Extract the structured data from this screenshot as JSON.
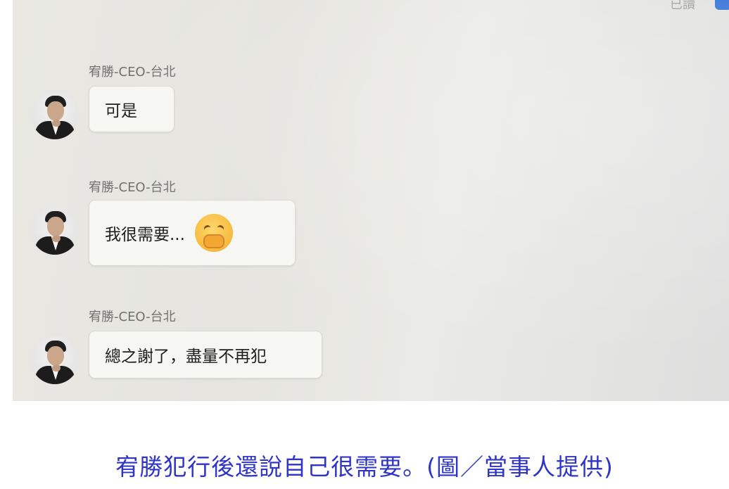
{
  "header": {
    "read_status": "已讀"
  },
  "messages": [
    {
      "sender": "宥勝-CEO-台北",
      "text": "可是",
      "emoji": null
    },
    {
      "sender": "宥勝-CEO-台北",
      "text": "我很需要...",
      "emoji": "covering-mouth-face-emoji"
    },
    {
      "sender": "宥勝-CEO-台北",
      "text": "總之謝了，盡量不再犯",
      "emoji": null
    }
  ],
  "caption": "宥勝犯行後還說自己很需要。(圖／當事人提供)",
  "colors": {
    "caption": "#2f34c9",
    "badge": "#2f6fd6",
    "bubble_bg": "#f6f6f3"
  }
}
